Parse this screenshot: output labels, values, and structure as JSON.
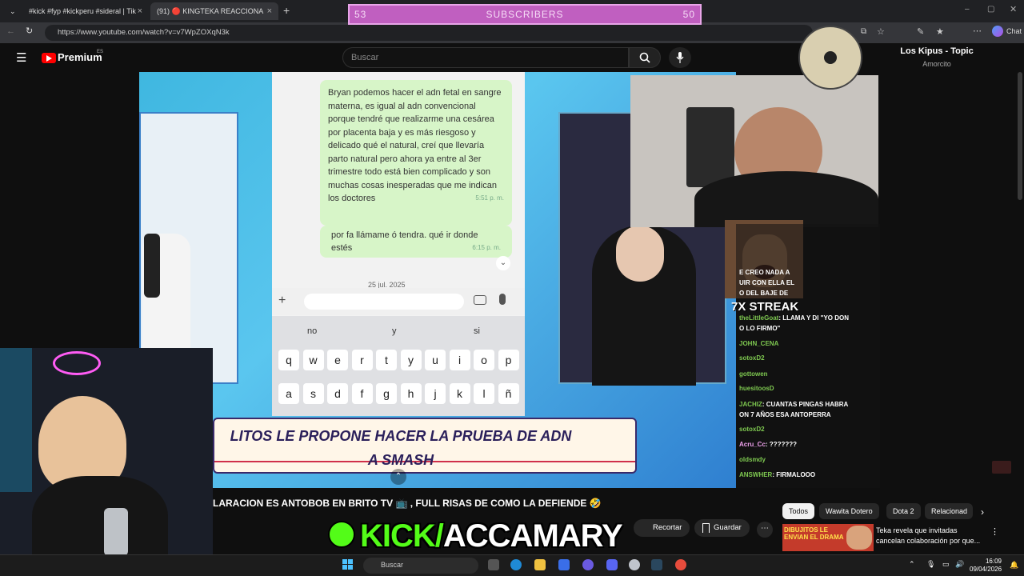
{
  "browser": {
    "tabs": [
      {
        "label": "#kick #fyp #kickperu #sideral | Tik"
      },
      {
        "label": "(91) 🔴 KINGTEKA REACCIONA"
      }
    ],
    "url": "https://www.youtube.com/watch?v=v7WpZOXqN3k",
    "chat_label": "Chat"
  },
  "subscribers": {
    "left": "53",
    "label": "SUBSCRIBERS",
    "right": "50"
  },
  "youtube": {
    "logo": "Premium",
    "region": "ES",
    "search_placeholder": "Buscar"
  },
  "video": {
    "message1": "Bryan podemos hacer el adn fetal en sangre materna, es igual al adn convencional porque tendré que realizarme una cesárea por placenta baja y es más riesgoso y delicado qué el natural, creí que llevaría parto natural pero ahora ya entre al 3er trimestre todo está bien complicado y son muchas cosas inesperadas que me indican los doctores",
    "message1_time": "5:51 p. m.",
    "message2": "por fa llámame ó tendra. qué ir donde estés",
    "message2_time": "6:15 p. m.",
    "date_chip": "25 jul. 2025",
    "suggestions": [
      "no",
      "y",
      "si"
    ],
    "row1": [
      "q",
      "w",
      "e",
      "r",
      "t",
      "y",
      "u",
      "i",
      "o",
      "p"
    ],
    "row2": [
      "a",
      "s",
      "d",
      "f",
      "g",
      "h",
      "j",
      "k",
      "l",
      "ñ"
    ],
    "banner_line1": "LITOS LE PROPONE HACER LA PRUEBA DE ADN",
    "banner_line2": "A SMASH"
  },
  "stream_chat": {
    "streak": "7X STREAK",
    "lines": [
      {
        "user": "",
        "text": "E CREO NADA A"
      },
      {
        "user": "",
        "text": "UIR CON ELLA EL"
      },
      {
        "user": "",
        "text": "O DEL BAJE DE"
      },
      {
        "user": "theLittleGoat",
        "text": "LLAMA Y DI \"YO DON"
      },
      {
        "user": "",
        "text": "O LO FIRMO\""
      },
      {
        "user": "JOHN_CENA",
        "text": ""
      },
      {
        "user": "sotoxD2",
        "text": ""
      },
      {
        "user": "gottowen",
        "text": ""
      },
      {
        "user": "huesitoosD",
        "text": ""
      },
      {
        "user": "JACHIZ",
        "text": "CUANTAS PINGAS HABRA"
      },
      {
        "user": "",
        "text": "ON 7 AÑOS ESA ANTOPERRA"
      },
      {
        "user": "sotoxD2",
        "text": ""
      },
      {
        "user": "Acru_Cc",
        "text": "???????"
      },
      {
        "user": "oldsmdy",
        "text": ""
      },
      {
        "user": "ANSWHER",
        "text": "FIRMALOOO"
      }
    ]
  },
  "now_playing": {
    "title": "Los Kipus - Topic",
    "subtitle": "Amorcito"
  },
  "below_video": {
    "title": "LARACION ES ANTOBOB EN BRITO TV 📺 , FULL RISAS DE COMO LA DEFIENDE 🤣",
    "chips": [
      "Todos",
      "Wawita Dotero",
      "Dota 2",
      "Relacionad"
    ],
    "actions": [
      "Recortar",
      "Guardar"
    ],
    "kick_prefix": "KICK/",
    "kick_name": "ACCAMARY",
    "rec_title": "Teka revela que invitadas cancelan colaboración por que...",
    "rec_thumb_text": "DIBUJITOS LE ENVIAN EL DRAMA"
  },
  "taskbar": {
    "search": "Buscar",
    "time": "16:09",
    "date": "09/04/2026"
  }
}
